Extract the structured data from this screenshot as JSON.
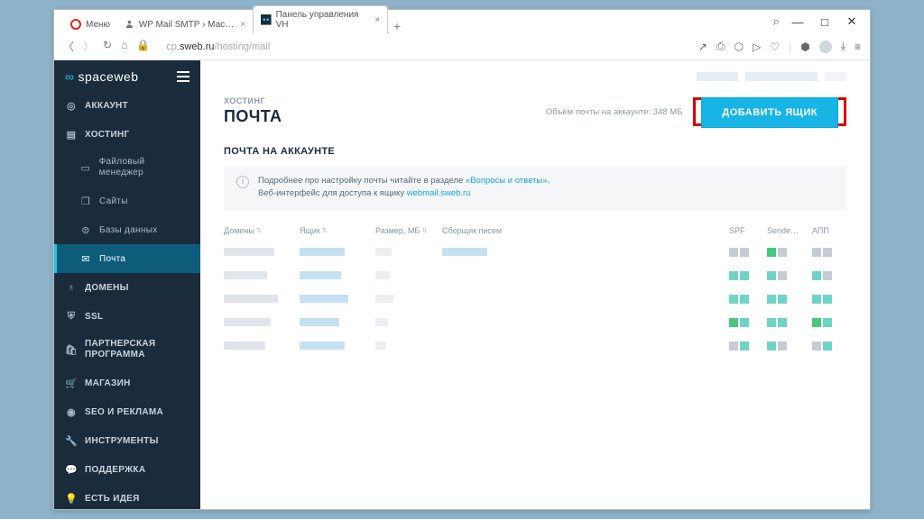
{
  "browser": {
    "tabs": [
      {
        "label": "Меню"
      },
      {
        "label": "WP Mail SMTP › Мастер у"
      },
      {
        "label": "Панель управления VH"
      }
    ],
    "url_prefix": "cp.",
    "url_host": "sweb.ru",
    "url_path": "/hosting/mail",
    "win": {
      "search": "⌕",
      "min": "—",
      "max": "□",
      "close": "✕"
    }
  },
  "brand": "spaceweb",
  "sidebar": {
    "items": [
      {
        "label": "АККАУНТ",
        "icon": "user"
      },
      {
        "label": "ХОСТИНГ",
        "icon": "server"
      },
      {
        "label": "Файловый менеджер",
        "sub": true,
        "icon": "folder"
      },
      {
        "label": "Сайты",
        "sub": true,
        "icon": "layers"
      },
      {
        "label": "Базы данных",
        "sub": true,
        "icon": "db"
      },
      {
        "label": "Почта",
        "sub": true,
        "icon": "mail",
        "active": true
      },
      {
        "label": "ДОМЕНЫ",
        "icon": "globe"
      },
      {
        "label": "SSL",
        "icon": "shield"
      },
      {
        "label": "ПАРТНЕРСКАЯ ПРОГРАММА",
        "icon": "bag"
      },
      {
        "label": "МАГАЗИН",
        "icon": "cart"
      },
      {
        "label": "SEO И РЕКЛАМА",
        "icon": "target"
      },
      {
        "label": "ИНСТРУМЕНТЫ",
        "icon": "wrench"
      },
      {
        "label": "ПОДДЕРЖКА",
        "icon": "chat"
      },
      {
        "label": "ЕСТЬ ИДЕЯ",
        "icon": "bulb"
      }
    ]
  },
  "header": {
    "breadcrumb": "ХОСТИНГ",
    "title": "ПОЧТА",
    "quota": "Объём почты на аккаунте: 348 МБ",
    "button": "ДОБАВИТЬ ЯЩИК"
  },
  "section_title": "ПОЧТА НА АККАУНТЕ",
  "info": {
    "text1": "Подробнее про настройку почты читайте в разделе ",
    "link1": "«Вопросы и ответы»",
    "text2": ".",
    "text3": "Веб-интерфейс для доступа к ящику ",
    "link2": "webmail.sweb.ru"
  },
  "columns": [
    "Домены",
    "Ящик",
    "Размер, МБ",
    "Сборщик писем",
    "",
    "SPF",
    "Sende…",
    "АПП"
  ],
  "rows": 5
}
